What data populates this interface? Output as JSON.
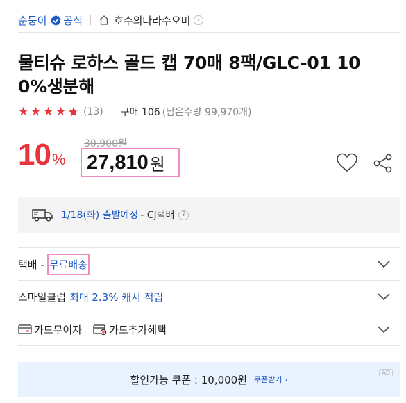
{
  "seller": {
    "name": "순둥이",
    "official_label": "공식",
    "store_name": "호수의나라수오미"
  },
  "product": {
    "title": "물티슈 로하스 골드 캡 70매 8팩/GLC-01 100%생분해"
  },
  "rating": {
    "stars": 4.5,
    "count_text": "(13)",
    "purchase_text": "구매 106",
    "remaining_text": "(남은수량 99,970개)"
  },
  "price": {
    "discount_value": "10",
    "discount_unit": "%",
    "original_price": "30,900원",
    "sale_price": "27,810",
    "sale_unit": "원"
  },
  "delivery": {
    "date_text": "1/18(화) 출발예정",
    "carrier_text": "- CJ택배",
    "help_glyph": "?"
  },
  "shipping": {
    "label": "택배 -",
    "value": "무료배송"
  },
  "smileclub": {
    "label": "스마일클럽",
    "value": "최대 2.3% 캐시 적립"
  },
  "cards": {
    "interest_free_label": "카드무이자",
    "extra_benefit_label": "카드추가혜택"
  },
  "coupon": {
    "text": "할인가능 쿠폰 : 10,000원",
    "link_text": "쿠폰받기 ›",
    "ad_label": "AD"
  },
  "colors": {
    "accent_blue": "#1a56c4",
    "sale_red": "#e8343b",
    "highlight_pink": "#f08cc0",
    "coupon_bg": "#e9f3ff"
  }
}
